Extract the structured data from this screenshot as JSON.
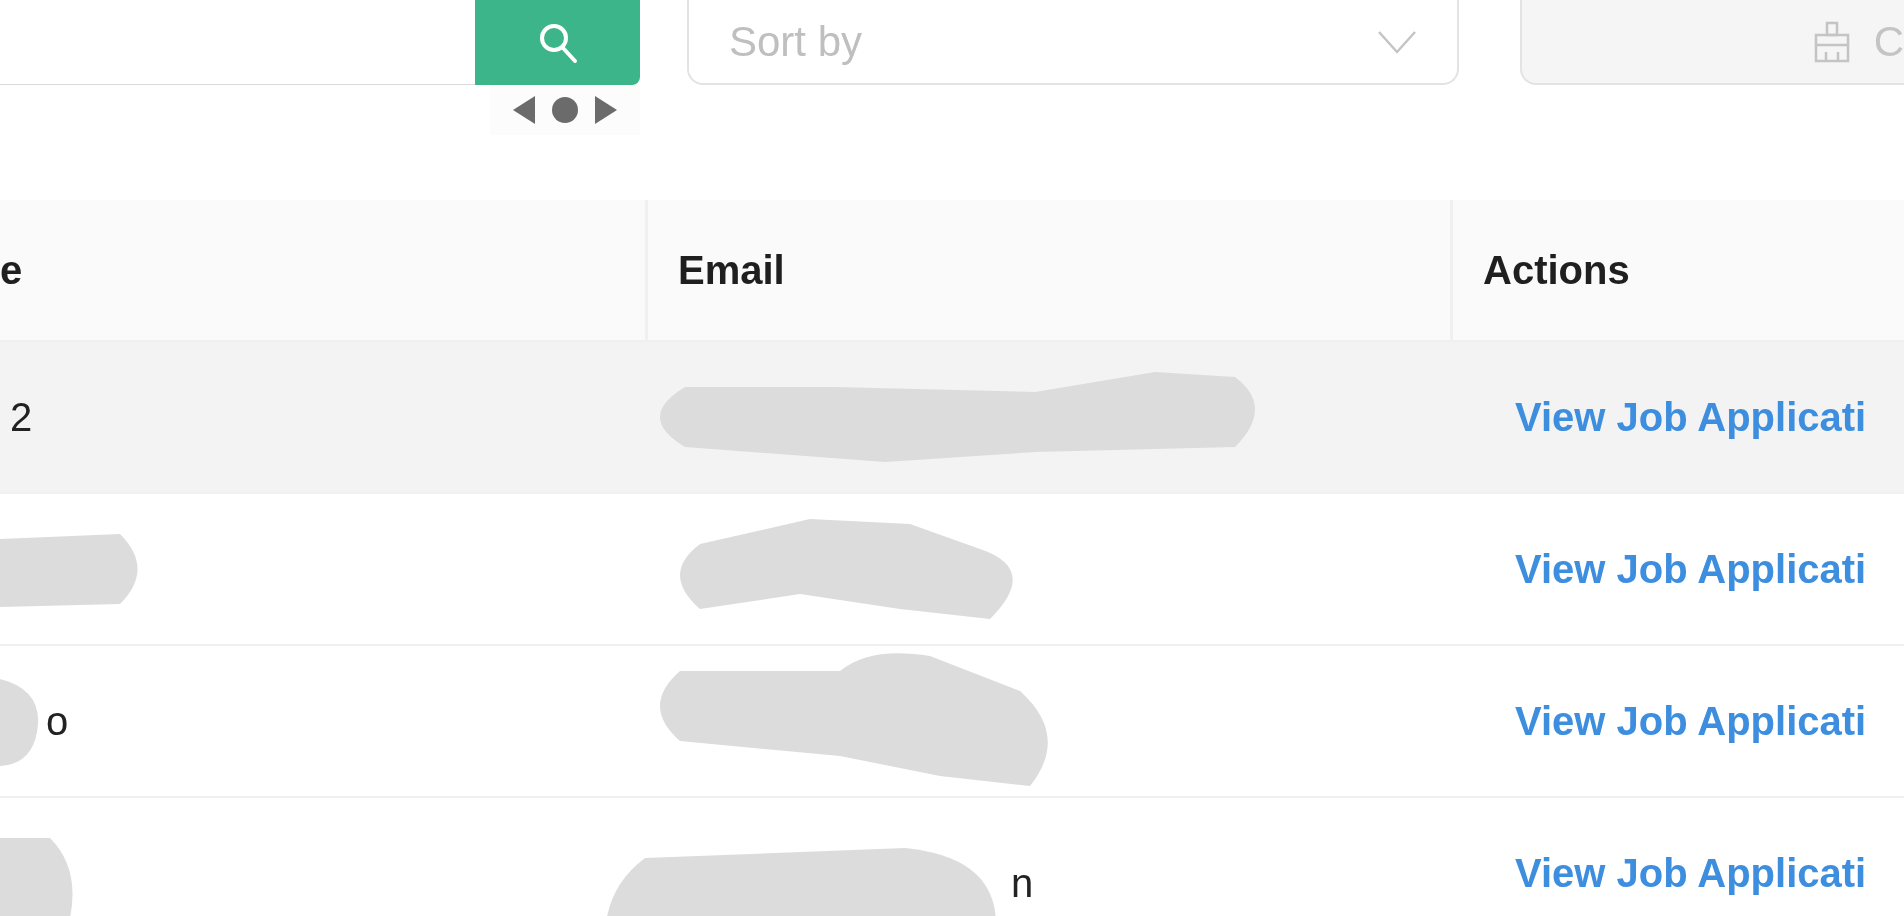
{
  "toolbar": {
    "search_button": {
      "kind": "search"
    },
    "sort": {
      "placeholder": "Sort by"
    },
    "clear_button": {
      "label": "C",
      "disabled": true
    }
  },
  "table": {
    "columns": [
      "e",
      "Email",
      "Actions"
    ],
    "rows": [
      {
        "name": "2",
        "email": "",
        "action": "View Job Applicati",
        "highlighted": true
      },
      {
        "name": "",
        "email": "",
        "action": "View Job Applicati",
        "highlighted": false
      },
      {
        "name": "o",
        "email": "",
        "action": "View Job Applicati",
        "highlighted": false
      },
      {
        "name": "",
        "email": "n",
        "action": "View Job Applicati",
        "highlighted": false
      }
    ]
  }
}
